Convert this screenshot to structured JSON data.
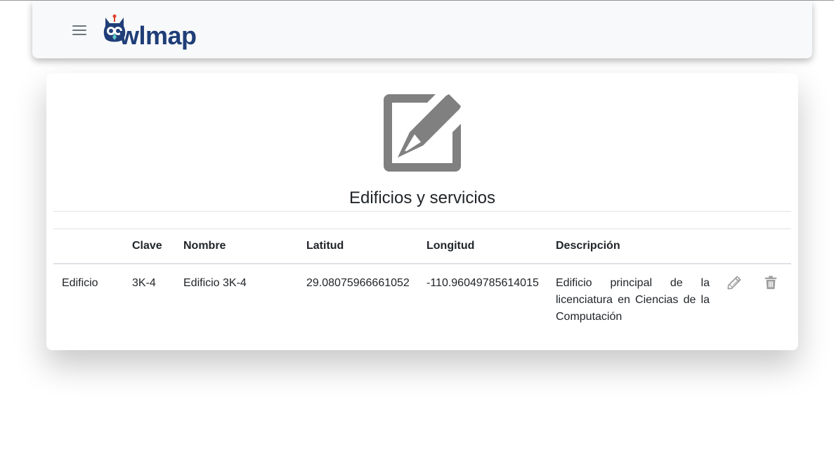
{
  "navbar": {
    "menu_icon": "hamburger-menu-icon",
    "logo_text": "wlmap",
    "logo_icon": "owl-logo-icon"
  },
  "card": {
    "hero_icon": "edit-square-icon",
    "title": "Edificios y servicios"
  },
  "table": {
    "headers": [
      "",
      "Clave",
      "Nombre",
      "Latitud",
      "Longitud",
      "Descripción",
      "",
      ""
    ],
    "rows": [
      {
        "tipo": "Edificio",
        "clave": "3K-4",
        "nombre": "Edificio 3K-4",
        "latitud": "29.08075966661052",
        "longitud": "-110.96049785614015",
        "descripcion": "Edificio principal de la licenciatura en Ciencias de la Computación",
        "edit_icon": "pencil-icon",
        "delete_icon": "trash-icon"
      }
    ]
  },
  "colors": {
    "navbar_bg": "#f8f9fa",
    "logo_blue": "#1f3e78",
    "icon_gray": "#808080",
    "action_gray": "#9e9e9e"
  }
}
